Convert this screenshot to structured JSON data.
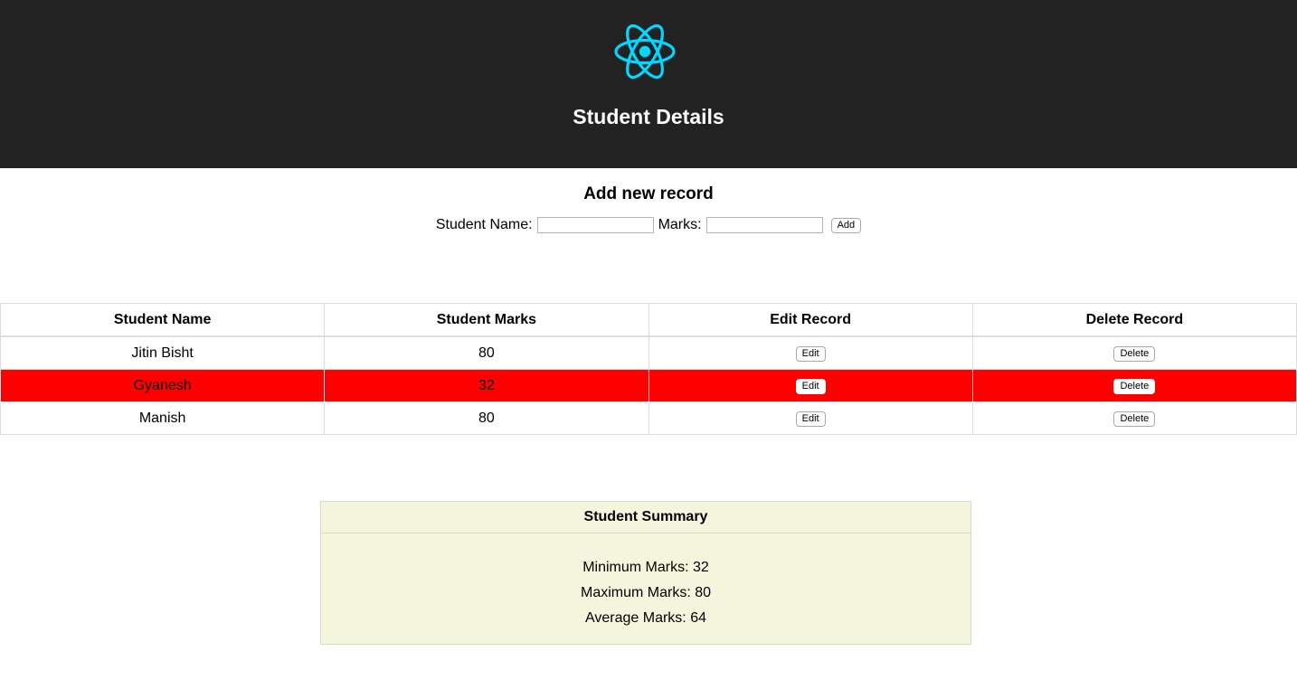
{
  "header": {
    "logo": "react-atom-logo",
    "logo_color": "#00d8ff",
    "background": "#222222",
    "title": "Student Details"
  },
  "add_record": {
    "title": "Add new record",
    "name_label": "Student Name:",
    "name_value": "",
    "marks_label": "Marks:",
    "marks_value": "",
    "add_button": "Add"
  },
  "table": {
    "columns": [
      "Student Name",
      "Student Marks",
      "Edit Record",
      "Delete Record"
    ],
    "highlight_color": "#ff0000",
    "rows": [
      {
        "name": "Jitin Bisht",
        "marks": "80",
        "edit": "Edit",
        "delete": "Delete",
        "highlighted": false
      },
      {
        "name": "Gyanesh",
        "marks": "32",
        "edit": "Edit",
        "delete": "Delete",
        "highlighted": true
      },
      {
        "name": "Manish",
        "marks": "80",
        "edit": "Edit",
        "delete": "Delete",
        "highlighted": false
      }
    ]
  },
  "summary": {
    "title": "Student Summary",
    "background": "#f3f5dc",
    "min_line": "Minimum Marks: 32",
    "max_line": "Maximum Marks: 80",
    "avg_line": "Average Marks: 64"
  }
}
